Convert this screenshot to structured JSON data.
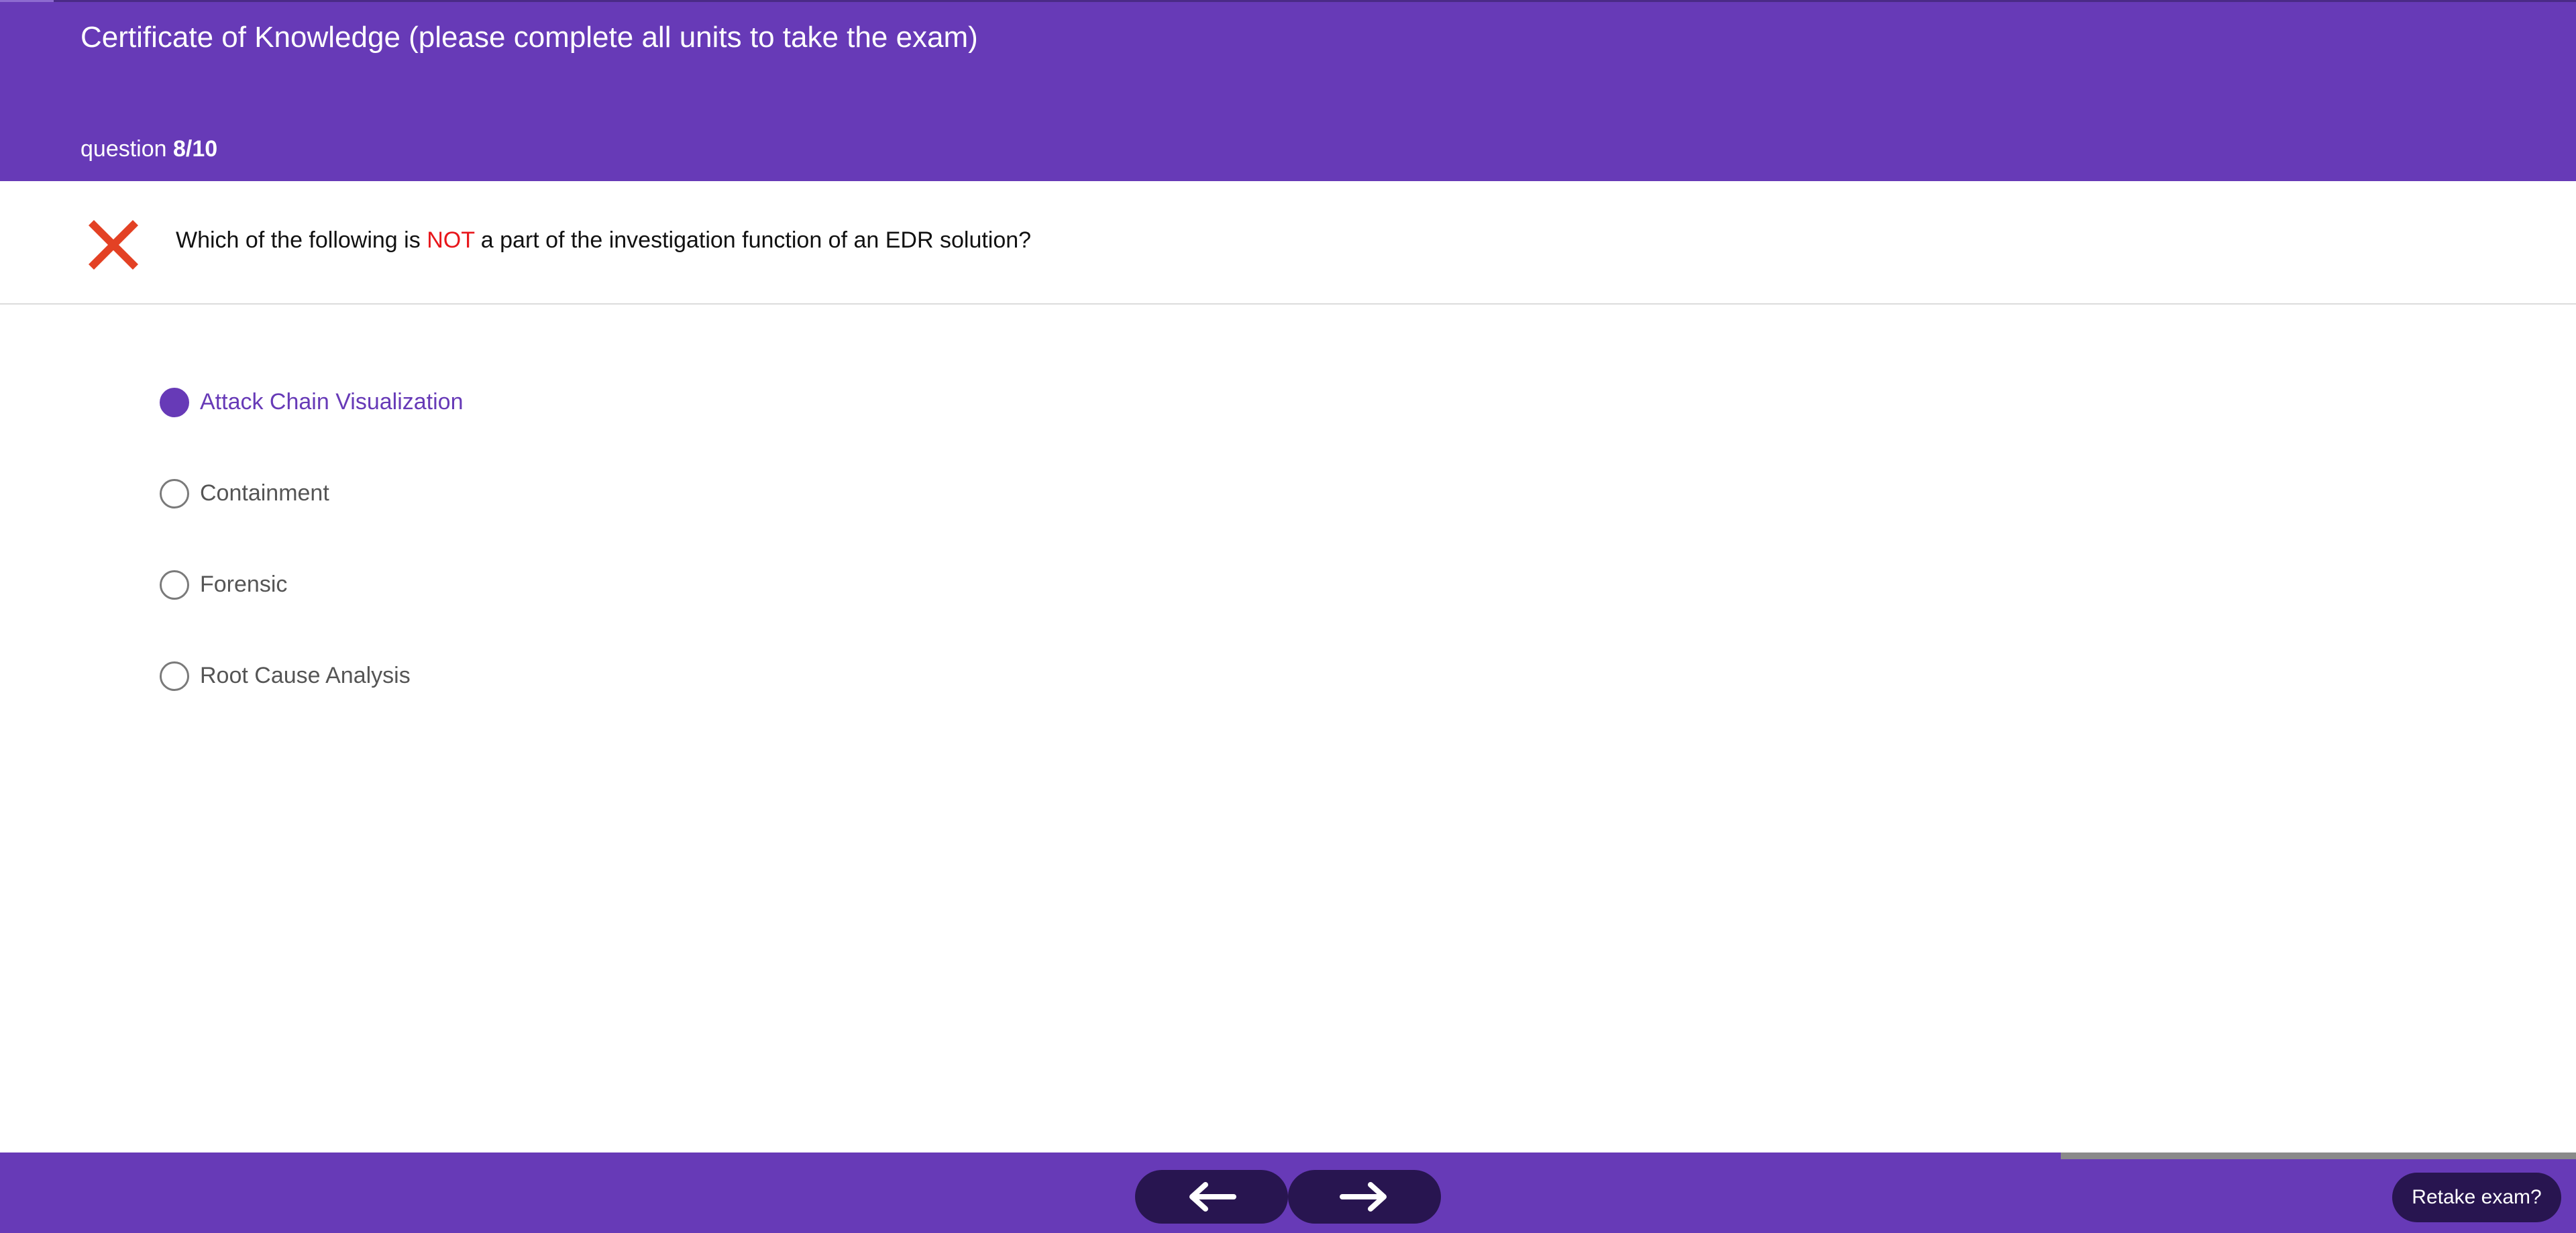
{
  "header": {
    "course_title": "Certificate of Knowledge (please complete all units to take the exam)",
    "progress_prefix": "question",
    "progress_value": "8/10",
    "color": "#673ab7"
  },
  "question": {
    "result_icon": "wrong-answer-x-icon",
    "result_color": "#e34124",
    "text_before": "Which of the following is",
    "text_emphasis": "NOT",
    "text_after": "a part of the investigation function of an EDR solution?",
    "emphasis_color": "#e8161b"
  },
  "options": [
    {
      "label": "Attack Chain Visualization",
      "selected": true
    },
    {
      "label": "Containment",
      "selected": false
    },
    {
      "label": "Forensic",
      "selected": false
    },
    {
      "label": "Root Cause Analysis",
      "selected": false
    }
  ],
  "footer": {
    "prev_icon": "arrow-left-icon",
    "next_icon": "arrow-right-icon",
    "retake_label": "Retake exam?",
    "button_color": "#281550",
    "progress_fraction": 0.8
  }
}
